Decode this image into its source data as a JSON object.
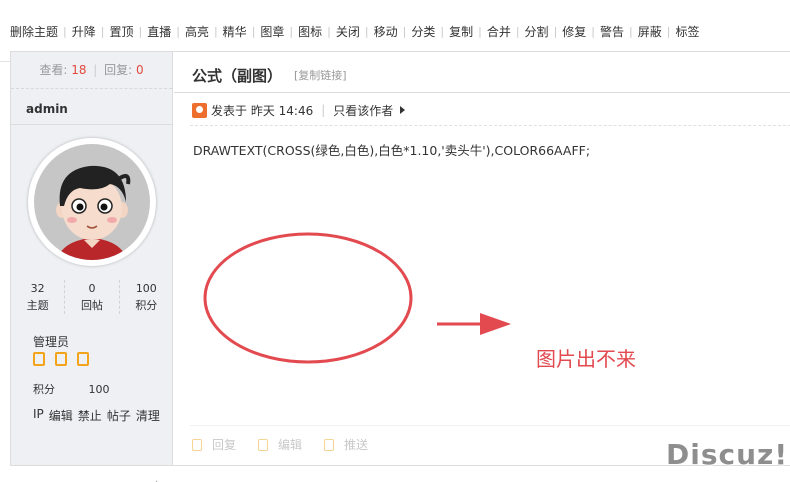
{
  "toolbar": {
    "items": [
      "删除主题",
      "升降",
      "置顶",
      "直播",
      "高亮",
      "精华",
      "图章",
      "图标",
      "关闭",
      "移动",
      "分类",
      "复制",
      "合并",
      "分割",
      "修复",
      "警告",
      "屏蔽",
      "标签"
    ],
    "separator": "|"
  },
  "sidebar": {
    "views_label": "查看:",
    "views_value": "18",
    "replies_label": "回复:",
    "replies_value": "0",
    "username": "admin",
    "counts": [
      {
        "value": "32",
        "label": "主题"
      },
      {
        "value": "0",
        "label": "回帖"
      },
      {
        "value": "100",
        "label": "积分"
      }
    ],
    "group": "管理员",
    "star_count": 3,
    "points_label": "积分",
    "points_value": "100",
    "admin_links": [
      "IP",
      "编辑",
      "禁止",
      "帖子",
      "清理"
    ]
  },
  "post": {
    "title": "公式（副图）",
    "copy_link": "[复制链接]",
    "posted_at": "发表于 昨天 14:46",
    "only_author": "只看该作者",
    "content": "DRAWTEXT(CROSS(绿色,白色),白色*1.10,'卖头牛'),COLOR66AAFF;",
    "annotation_text": "图片出不来",
    "annotation_color": "#e24a50",
    "actions": [
      "回复",
      "编辑",
      "推送"
    ]
  },
  "watermark": "Discuz!",
  "footer_mark": "·"
}
